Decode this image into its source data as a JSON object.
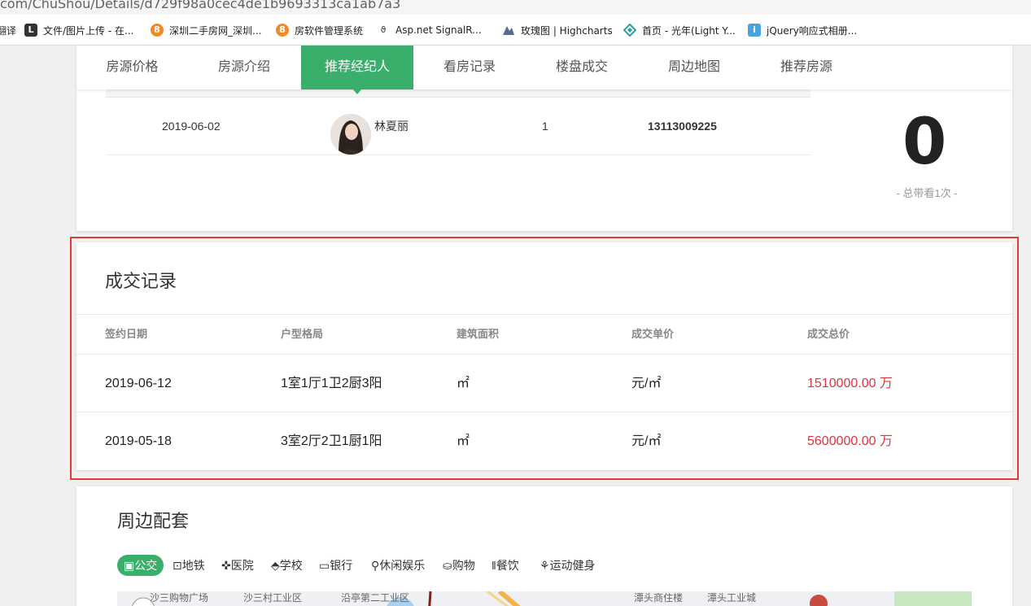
{
  "browser": {
    "url": "com/ChuShou/Details/d729f98a0cec4de1b9693313ca1ab7a3",
    "bookmarks": [
      {
        "label": "翻译",
        "icon": "translate-icon"
      },
      {
        "label": "文件/图片上传 - 在...",
        "icon": "upload-icon"
      },
      {
        "label": "深圳二手房网_深圳...",
        "icon": "house-icon"
      },
      {
        "label": "房软件管理系统",
        "icon": "house-icon"
      },
      {
        "label": "Asp.net SignalR...",
        "icon": "signalr-icon"
      },
      {
        "label": "玫瑰图 | Highcharts",
        "icon": "highcharts-icon"
      },
      {
        "label": "首页 - 光年(Light Y...",
        "icon": "diamond-icon"
      },
      {
        "label": "jQuery响应式相册...",
        "icon": "jquery-icon"
      }
    ]
  },
  "tabs": [
    {
      "label": "房源价格"
    },
    {
      "label": "房源介绍"
    },
    {
      "label": "推荐经纪人"
    },
    {
      "label": "看房记录"
    },
    {
      "label": "楼盘成交"
    },
    {
      "label": "周边地图"
    },
    {
      "label": "推荐房源"
    }
  ],
  "active_tab": "推荐经纪人",
  "viewing": {
    "row": {
      "date": "2019-06-02",
      "agent_name": "林夏丽",
      "count": "1",
      "phone": "13113009225"
    },
    "total": "0",
    "total_label": "- 总带看1次 -"
  },
  "deals": {
    "title": "成交记录",
    "headers": [
      "签约日期",
      "户型格局",
      "建筑面积",
      "成交单价",
      "成交总价"
    ],
    "rows": [
      {
        "date": "2019-06-12",
        "layout": "1室1厅1卫2厨3阳",
        "area": "㎡",
        "unit_price": "元/㎡",
        "total": "1510000.00 万"
      },
      {
        "date": "2019-05-18",
        "layout": "3室2厅2卫1厨1阳",
        "area": "㎡",
        "unit_price": "元/㎡",
        "total": "5600000.00 万"
      }
    ]
  },
  "around": {
    "title": "周边配套",
    "categories": [
      {
        "label": "公交",
        "icon": "bus-icon"
      },
      {
        "label": "地铁",
        "icon": "subway-icon"
      },
      {
        "label": "医院",
        "icon": "hospital-icon"
      },
      {
        "label": "学校",
        "icon": "school-icon"
      },
      {
        "label": "银行",
        "icon": "bank-icon"
      },
      {
        "label": "休闲娱乐",
        "icon": "leisure-icon"
      },
      {
        "label": "购物",
        "icon": "shopping-icon"
      },
      {
        "label": "餐饮",
        "icon": "dining-icon"
      },
      {
        "label": "运动健身",
        "icon": "fitness-icon"
      }
    ],
    "active_category": "公交",
    "map_labels": [
      "沙三购物广场",
      "沙三村工业区",
      "沿亭第二工业区",
      "潭头商住楼",
      "潭头工业城"
    ]
  },
  "colors": {
    "accent": "#3aae6b",
    "price_red": "#d9363e",
    "highlight_border": "#e53935"
  }
}
